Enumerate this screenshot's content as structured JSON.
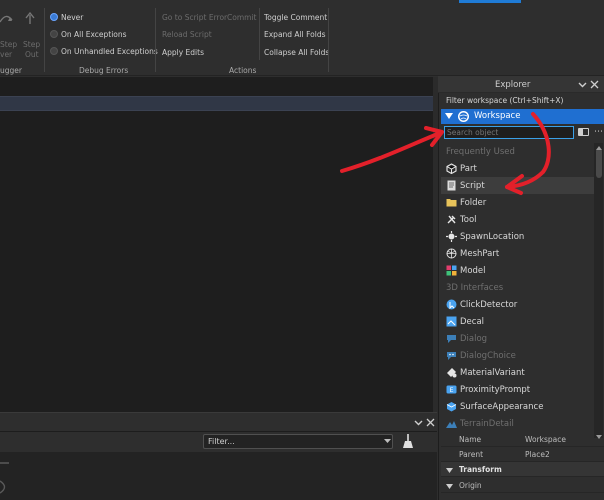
{
  "ribbon": {
    "debugger_section": "ugger",
    "step_over": [
      "Step",
      "ver"
    ],
    "step_out": [
      "Step",
      "Out"
    ],
    "debug_errors": {
      "label": "Debug Errors",
      "options": [
        "Never",
        "On All Exceptions",
        "On Unhandled Exceptions"
      ],
      "selected": "Never"
    },
    "actions": {
      "label": "Actions",
      "items": [
        "Go to Script Error",
        "Commit",
        "Reload Script",
        "Apply Edits",
        "Toggle Comment",
        "Expand All Folds",
        "Collapse All Folds"
      ]
    }
  },
  "bottom_panel": {
    "filter_placeholder": "Filter..."
  },
  "explorer": {
    "title": "Explorer",
    "filter_label": "Filter workspace (Ctrl+Shift+X)",
    "root": "Workspace",
    "search_placeholder": "Search object",
    "frequently_used_label": "Frequently Used",
    "frequently_used": [
      {
        "label": "Part",
        "icon": "part-icon"
      },
      {
        "label": "Script",
        "icon": "script-icon"
      },
      {
        "label": "Folder",
        "icon": "folder-icon"
      },
      {
        "label": "Tool",
        "icon": "tool-icon"
      },
      {
        "label": "SpawnLocation",
        "icon": "spawn-location-icon"
      },
      {
        "label": "MeshPart",
        "icon": "meshpart-icon"
      },
      {
        "label": "Model",
        "icon": "model-icon"
      }
    ],
    "interfaces_label": "3D Interfaces",
    "interfaces": [
      {
        "label": "ClickDetector",
        "icon": "click-detector-icon"
      },
      {
        "label": "Decal",
        "icon": "decal-icon"
      },
      {
        "label": "Dialog",
        "icon": "dialog-icon"
      },
      {
        "label": "DialogChoice",
        "icon": "dialog-choice-icon"
      },
      {
        "label": "MaterialVariant",
        "icon": "material-variant-icon"
      },
      {
        "label": "ProximityPrompt",
        "icon": "proximity-prompt-icon"
      },
      {
        "label": "SurfaceAppearance",
        "icon": "surface-appearance-icon"
      },
      {
        "label": "TerrainDetail",
        "icon": "terrain-detail-icon"
      }
    ]
  },
  "properties": {
    "name_key": "Name",
    "name_value": "Workspace",
    "parent_key": "Parent",
    "parent_value": "Place2",
    "transform_section": "Transform",
    "origin_key": "Origin"
  },
  "colors": {
    "accent": "#1f6fd1",
    "annotation": "#e3202a"
  }
}
